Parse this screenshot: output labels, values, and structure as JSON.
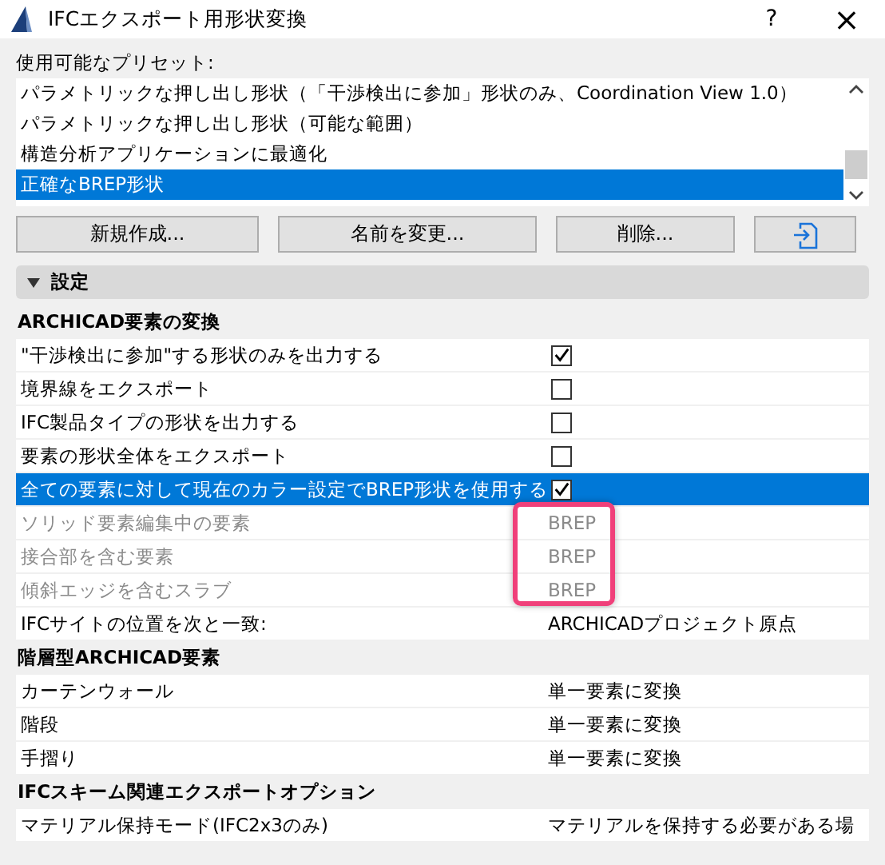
{
  "window": {
    "title": "IFCエクスポート用形状変換",
    "help": "?",
    "close": "×"
  },
  "presets": {
    "label": "使用可能なプリセット:",
    "items": [
      {
        "label": "パラメトリックな押し出し形状（「干渉検出に参加」形状のみ、Coordination View 1.0）",
        "selected": false
      },
      {
        "label": "パラメトリックな押し出し形状（可能な範囲）",
        "selected": false
      },
      {
        "label": "構造分析アプリケーションに最適化",
        "selected": false
      },
      {
        "label": "正確なBREP形状",
        "selected": true
      }
    ],
    "buttons": [
      "新規作成...",
      "名前を変更...",
      "削除..."
    ]
  },
  "section": {
    "title": "設定",
    "expanded": true
  },
  "groups": [
    {
      "title": "ARCHICAD要素の変換",
      "rows": [
        {
          "kind": "check",
          "label": "\"干渉検出に参加\"する形状のみを出力する",
          "checked": true,
          "selected": false,
          "disabled": false
        },
        {
          "kind": "check",
          "label": "境界線をエクスポート",
          "checked": false,
          "selected": false,
          "disabled": false
        },
        {
          "kind": "check",
          "label": "IFC製品タイプの形状を出力する",
          "checked": false,
          "selected": false,
          "disabled": false
        },
        {
          "kind": "check",
          "label": "要素の形状全体をエクスポート",
          "checked": false,
          "selected": false,
          "disabled": false
        },
        {
          "kind": "check",
          "label": "全ての要素に対して現在のカラー設定でBREP形状を使用する",
          "checked": true,
          "selected": true,
          "disabled": false
        },
        {
          "kind": "value",
          "label": "ソリッド要素編集中の要素",
          "value": "BREP",
          "selected": false,
          "disabled": true,
          "highlighted": true
        },
        {
          "kind": "value",
          "label": "接合部を含む要素",
          "value": "BREP",
          "selected": false,
          "disabled": true,
          "highlighted": true
        },
        {
          "kind": "value",
          "label": "傾斜エッジを含むスラブ",
          "value": "BREP",
          "selected": false,
          "disabled": true,
          "highlighted": true
        },
        {
          "kind": "value",
          "label": "IFCサイトの位置を次と一致:",
          "value": "ARCHICADプロジェクト原点",
          "selected": false,
          "disabled": false,
          "highlighted": false
        }
      ]
    },
    {
      "title": "階層型ARCHICAD要素",
      "rows": [
        {
          "kind": "value",
          "label": "カーテンウォール",
          "value": "単一要素に変換",
          "selected": false,
          "disabled": false,
          "highlighted": false
        },
        {
          "kind": "value",
          "label": "階段",
          "value": "単一要素に変換",
          "selected": false,
          "disabled": false,
          "highlighted": false
        },
        {
          "kind": "value",
          "label": "手摺り",
          "value": "単一要素に変換",
          "selected": false,
          "disabled": false,
          "highlighted": false
        }
      ]
    },
    {
      "title": "IFCスキーム関連エクスポートオプション",
      "rows": [
        {
          "kind": "value",
          "label": "マテリアル保持モード(IFC2x3のみ)",
          "value": "マテリアルを保持する必要がある場",
          "selected": false,
          "disabled": false,
          "highlighted": false
        }
      ]
    }
  ]
}
